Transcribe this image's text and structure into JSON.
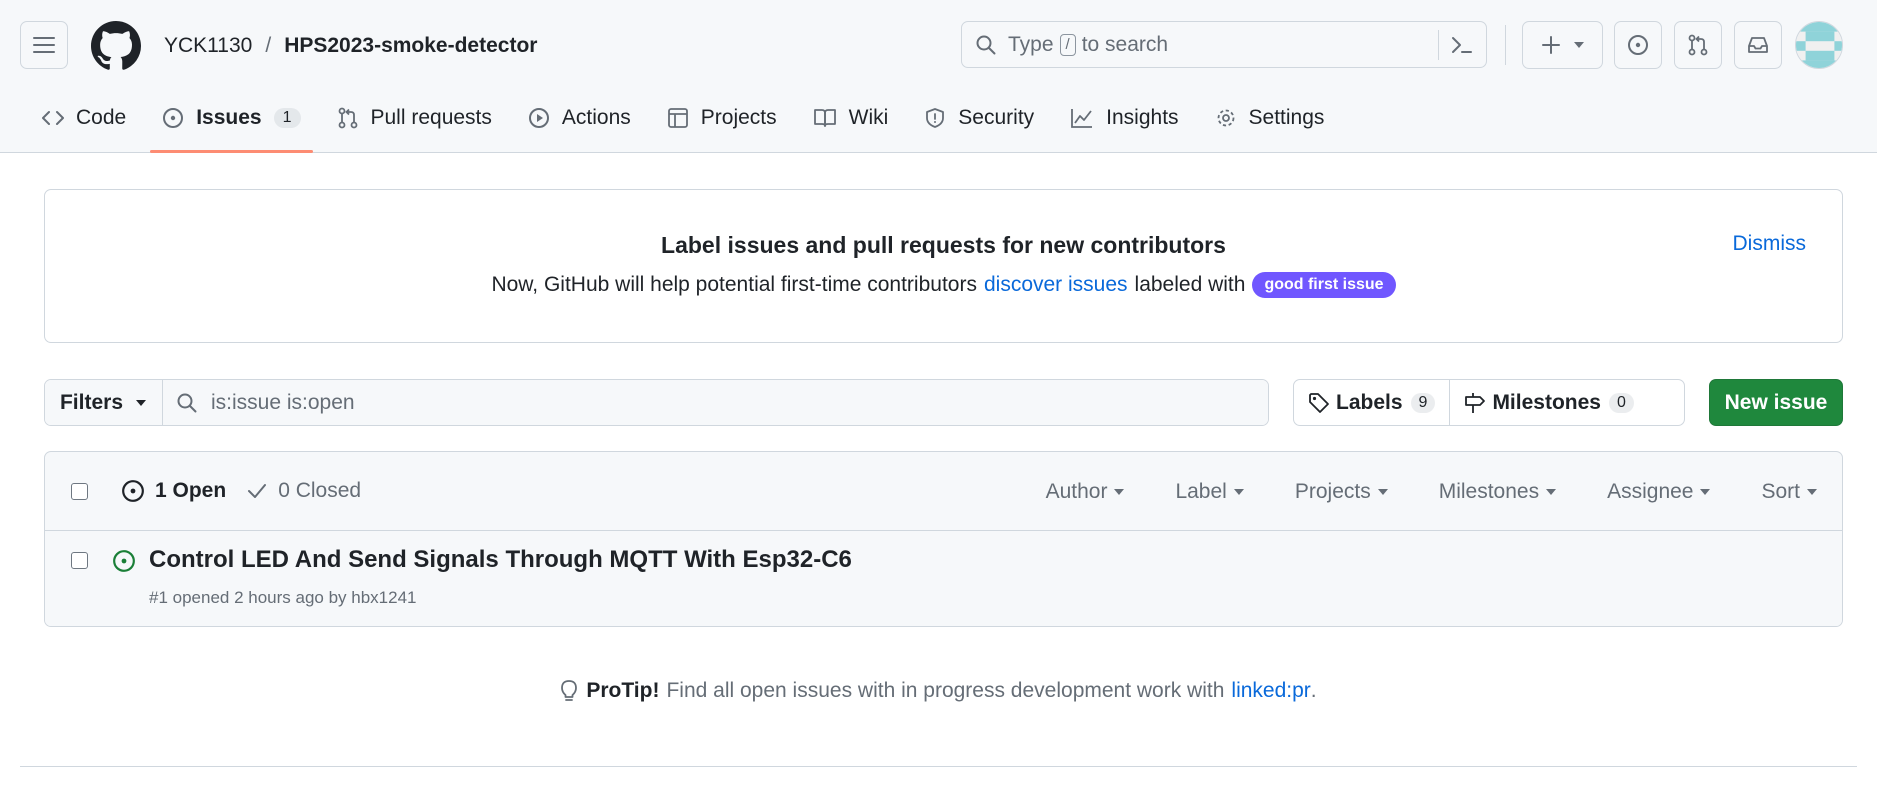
{
  "header": {
    "owner": "YCK1130",
    "separator": "/",
    "repo": "HPS2023-smoke-detector",
    "search": {
      "prefix": "Type",
      "key": "/",
      "suffix": "to search"
    }
  },
  "tabs": [
    {
      "label": "Code",
      "icon": "code-icon"
    },
    {
      "label": "Issues",
      "icon": "issue-opened-icon",
      "counter": "1",
      "selected": true
    },
    {
      "label": "Pull requests",
      "icon": "git-pull-request-icon"
    },
    {
      "label": "Actions",
      "icon": "play-icon"
    },
    {
      "label": "Projects",
      "icon": "table-icon"
    },
    {
      "label": "Wiki",
      "icon": "book-icon"
    },
    {
      "label": "Security",
      "icon": "shield-icon"
    },
    {
      "label": "Insights",
      "icon": "graph-icon"
    },
    {
      "label": "Settings",
      "icon": "gear-icon"
    }
  ],
  "banner": {
    "title": "Label issues and pull requests for new contributors",
    "text_before": "Now, GitHub will help potential first-time contributors",
    "link": "discover issues",
    "text_after": "labeled with",
    "label": "good first issue",
    "label_color": "#7057ff",
    "dismiss": "Dismiss"
  },
  "filterbar": {
    "filters_label": "Filters",
    "query": "is:issue is:open",
    "labels_label": "Labels",
    "labels_count": "9",
    "milestones_label": "Milestones",
    "milestones_count": "0",
    "new_issue": "New issue"
  },
  "list": {
    "open_label": "1 Open",
    "closed_label": "0 Closed",
    "sorts": [
      "Author",
      "Label",
      "Projects",
      "Milestones",
      "Assignee",
      "Sort"
    ],
    "issues": [
      {
        "title": "Control LED And Send Signals Through MQTT With Esp32-C6",
        "meta": "#1 opened 2 hours ago by hbx1241"
      }
    ]
  },
  "protip": {
    "bold": "ProTip!",
    "text": "Find all open issues with in progress development work with",
    "link": "linked:pr",
    "end": "."
  },
  "colors": {
    "accent_green": "#1f883d",
    "link_blue": "#0969da",
    "tab_underline": "#fd8c73",
    "open_green": "#1a7f37"
  }
}
